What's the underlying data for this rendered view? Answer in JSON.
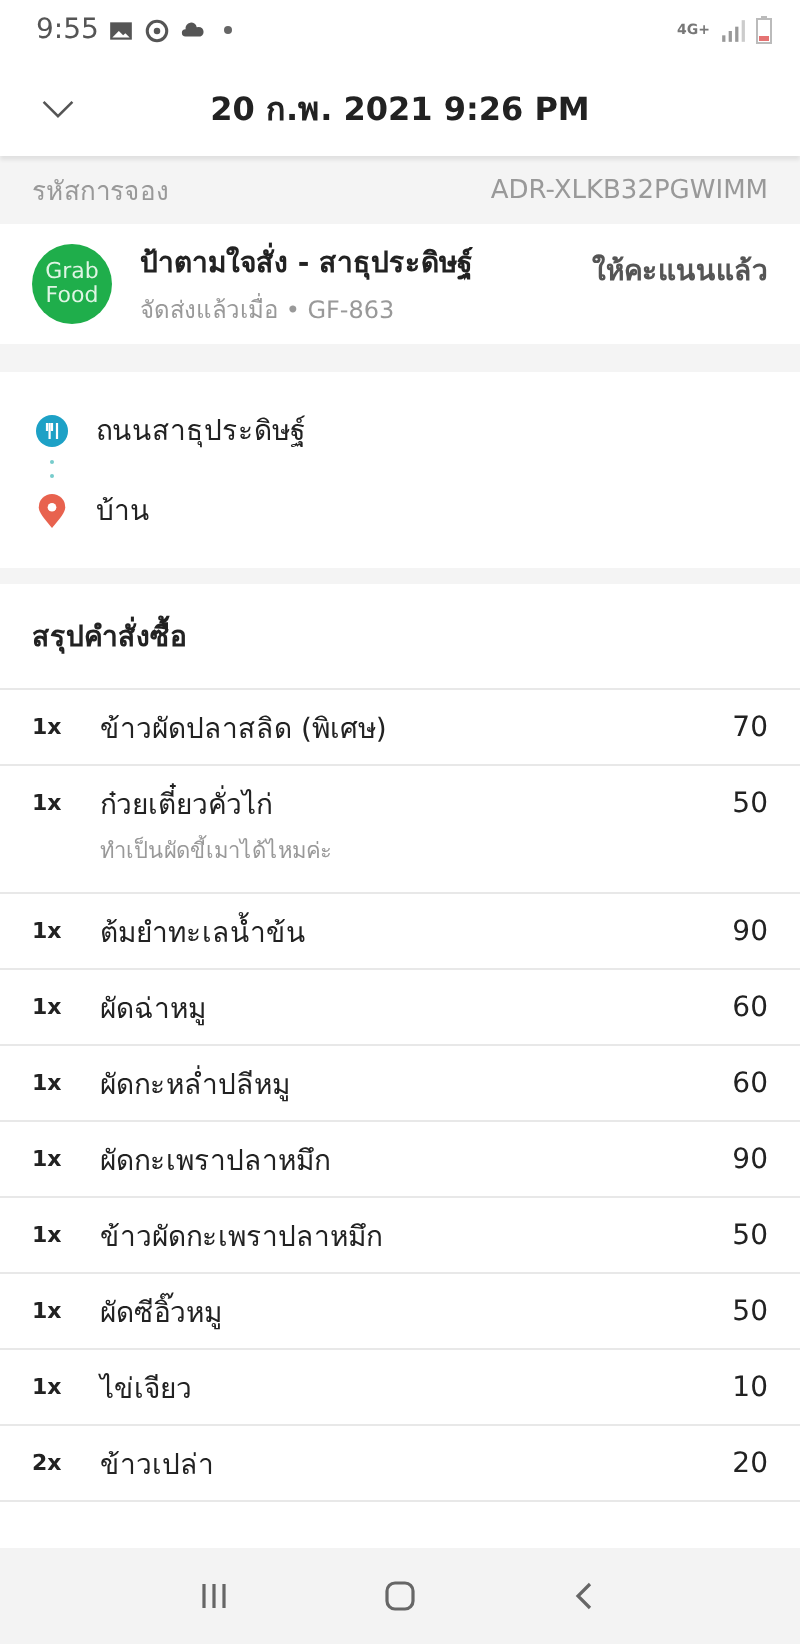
{
  "status_bar": {
    "time": "9:55",
    "network": "4G+"
  },
  "header": {
    "title": "20 ก.พ. 2021 9:26 PM"
  },
  "booking": {
    "label": "รหัสการจอง",
    "code": "ADR-XLKB32PGWIMM"
  },
  "restaurant": {
    "logo_lines": [
      "Grab",
      "Food"
    ],
    "name": "ป้าตามใจสั่ง - สาธุประดิษฐ์",
    "subtitle": "จัดส่งแล้วเมื่อ • GF-863",
    "rating_status": "ให้คะแนนแล้ว"
  },
  "route": [
    {
      "kind": "pickup",
      "label": "ถนนสาธุประดิษฐ์"
    },
    {
      "kind": "dropoff",
      "label": "บ้าน"
    }
  ],
  "order_summary": {
    "title": "สรุปคำสั่งซื้อ",
    "items": [
      {
        "qty": "1x",
        "name": "ข้าวผัดปลาสลิด (พิเศษ)",
        "price": "70"
      },
      {
        "qty": "1x",
        "name": "ก๋วยเตี๋ยวคั่วไก่",
        "price": "50",
        "note": "ทำเป็นผัดขี้เมาได้ไหมค่ะ"
      },
      {
        "qty": "1x",
        "name": "ต้มยำทะเลน้ำข้น",
        "price": "90"
      },
      {
        "qty": "1x",
        "name": "ผัดฉ่าหมู",
        "price": "60"
      },
      {
        "qty": "1x",
        "name": "ผัดกะหล่ำปลีหมู",
        "price": "60"
      },
      {
        "qty": "1x",
        "name": "ผัดกะเพราปลาหมึก",
        "price": "90"
      },
      {
        "qty": "1x",
        "name": "ข้าวผัดกะเพราปลาหมึก",
        "price": "50"
      },
      {
        "qty": "1x",
        "name": "ผัดซีอิ๊วหมู",
        "price": "50"
      },
      {
        "qty": "1x",
        "name": "ไข่เจียว",
        "price": "10"
      },
      {
        "qty": "2x",
        "name": "ข้าวเปล่า",
        "price": "20"
      }
    ]
  }
}
